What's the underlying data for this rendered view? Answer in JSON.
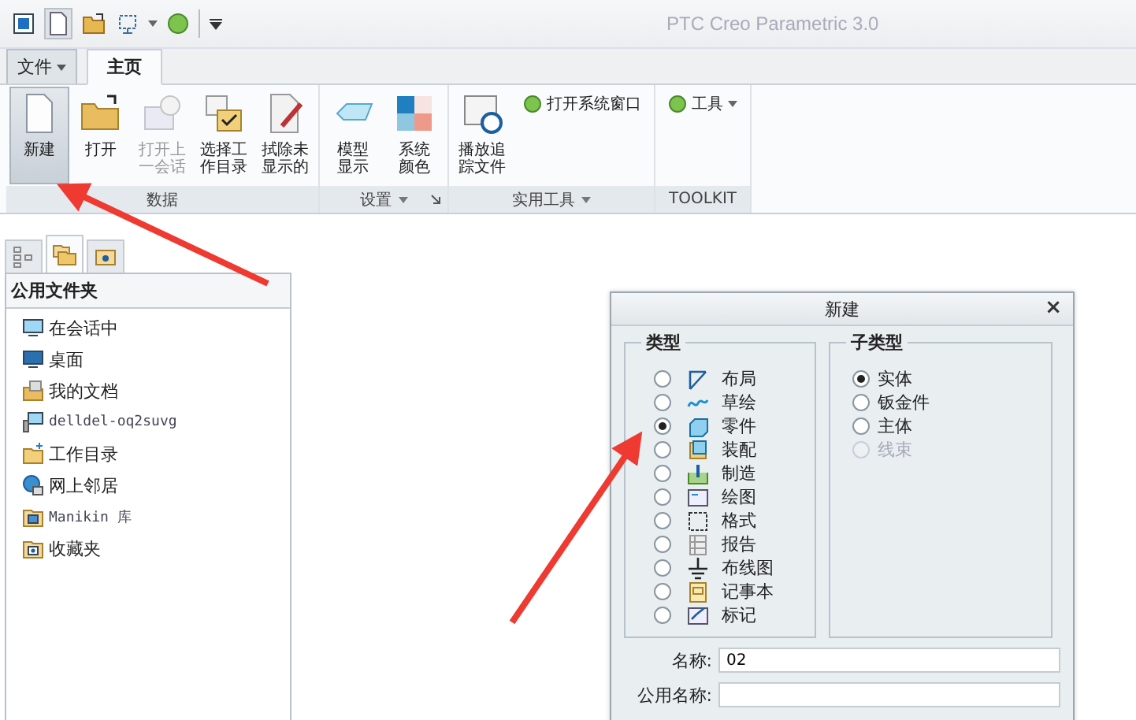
{
  "window": {
    "title": "PTC Creo Parametric 3.0"
  },
  "tabs": [
    {
      "label": "文件",
      "kind": "menu",
      "selected": false
    },
    {
      "label": "主页",
      "kind": "tab",
      "selected": true
    }
  ],
  "ribbon": {
    "groups": [
      {
        "label": "数据",
        "buttons": [
          {
            "label": "新建",
            "selected": true,
            "disabled": false
          },
          {
            "label": "打开",
            "selected": false,
            "disabled": false
          },
          {
            "label": "打开上一会话",
            "selected": false,
            "disabled": true
          },
          {
            "label": "选择工作目录",
            "selected": false,
            "disabled": false
          },
          {
            "label": "拭除未显示的",
            "selected": false,
            "disabled": false
          }
        ]
      },
      {
        "label": "设置",
        "dropdown": true,
        "launcher": true,
        "buttons": [
          {
            "label": "模型显示",
            "selected": false,
            "disabled": false
          },
          {
            "label": "系统颜色",
            "selected": false,
            "disabled": false
          }
        ]
      },
      {
        "label": "实用工具",
        "dropdown": true,
        "launcher": false,
        "buttons": [
          {
            "label": "播放追踪文件",
            "selected": false,
            "disabled": false
          }
        ],
        "small_buttons": [
          {
            "label": "打开系统窗口",
            "dropdown": false
          }
        ]
      },
      {
        "label": "TOOLKIT",
        "dropdown": false,
        "launcher": false,
        "small_buttons": [
          {
            "label": "工具",
            "dropdown": true
          }
        ]
      }
    ]
  },
  "navigator": {
    "tabs": [
      {
        "selected": false
      },
      {
        "selected": true
      },
      {
        "selected": false
      }
    ],
    "header": "公用文件夹",
    "items": [
      {
        "label": "在会话中",
        "mono": false
      },
      {
        "label": "桌面",
        "mono": false
      },
      {
        "label": "我的文档",
        "mono": false
      },
      {
        "label": "delldel-oq2suvg",
        "mono": true
      },
      {
        "label": "工作目录",
        "mono": false
      },
      {
        "label": "网上邻居",
        "mono": false
      },
      {
        "label": "Manikin 库",
        "mono": true
      },
      {
        "label": "收藏夹",
        "mono": false
      }
    ]
  },
  "dialog": {
    "title": "新建",
    "close": "×",
    "type_group": {
      "label": "类型",
      "options": [
        {
          "label": "布局",
          "selected": false
        },
        {
          "label": "草绘",
          "selected": false
        },
        {
          "label": "零件",
          "selected": true
        },
        {
          "label": "装配",
          "selected": false
        },
        {
          "label": "制造",
          "selected": false
        },
        {
          "label": "绘图",
          "selected": false
        },
        {
          "label": "格式",
          "selected": false
        },
        {
          "label": "报告",
          "selected": false
        },
        {
          "label": "布线图",
          "selected": false
        },
        {
          "label": "记事本",
          "selected": false
        },
        {
          "label": "标记",
          "selected": false
        }
      ]
    },
    "subtype_group": {
      "label": "子类型",
      "options": [
        {
          "label": "实体",
          "selected": true,
          "disabled": false
        },
        {
          "label": "钣金件",
          "selected": false,
          "disabled": false
        },
        {
          "label": "主体",
          "selected": false,
          "disabled": false
        },
        {
          "label": "线束",
          "selected": false,
          "disabled": true
        }
      ]
    },
    "name": {
      "label": "名称:",
      "value": "02"
    },
    "common_name": {
      "label": "公用名称:"
    }
  }
}
